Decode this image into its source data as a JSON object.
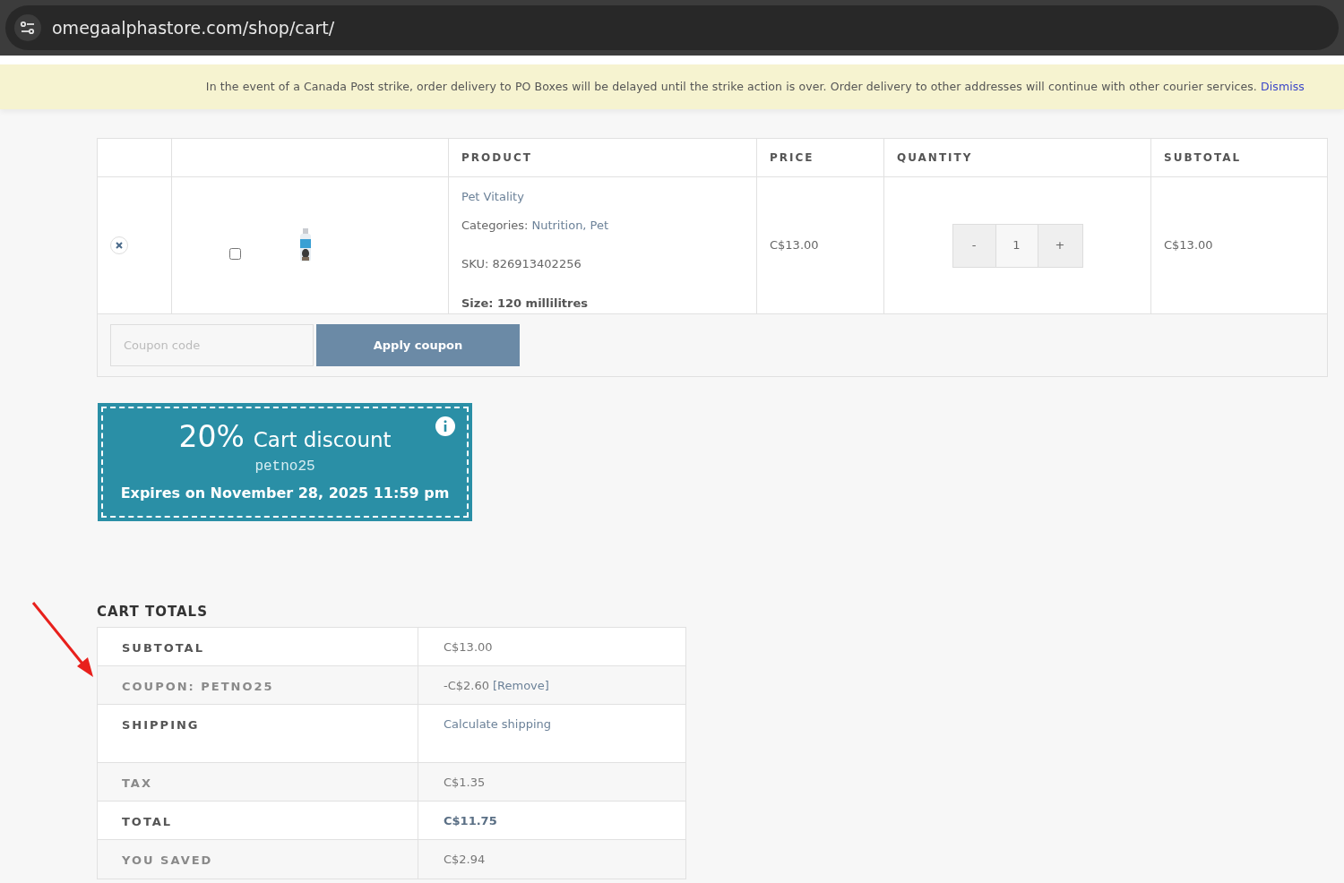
{
  "address_bar": {
    "url": "omegaalphastore.com/shop/cart/"
  },
  "notice": {
    "text": "In the event of a Canada Post strike, order delivery to PO Boxes will be delayed until the strike action is over. Order delivery to other addresses will continue with other courier services.",
    "link": "Dismiss"
  },
  "cart_table": {
    "columns": [
      "PRODUCT",
      "PRICE",
      "QUANTITY",
      "SUBTOTAL"
    ],
    "rows": [
      {
        "checked": false,
        "name": "Pet Vitality",
        "categories_label": "Categories:",
        "categories": [
          "Nutrition,",
          "Pet"
        ],
        "sku": "SKU: 826913402256",
        "size": "Size: 120 millilitres",
        "price": "C$13.00",
        "minus": "-",
        "quantity": "1",
        "plus": "+",
        "subtotal": "C$13.00"
      }
    ],
    "coupon_placeholder": "Coupon code",
    "apply_button": "Apply coupon"
  },
  "coupon_card": {
    "amount": "20%",
    "label": "Cart discount",
    "code": "petno25",
    "expires": "Expires on November 28, 2025 11:59 pm"
  },
  "cart_totals": {
    "title": "CART TOTALS",
    "rows": [
      {
        "label": "SUBTOTAL",
        "value": "C$13.00",
        "kind": "plain"
      },
      {
        "label": "COUPON: PETNO25",
        "value": "-C$2.60",
        "link": "[Remove]",
        "kind": "plain"
      },
      {
        "label": "SHIPPING",
        "link": "Calculate shipping",
        "kind": "tall"
      },
      {
        "label": "TAX",
        "value": "C$1.35",
        "kind": "plain"
      },
      {
        "label": "TOTAL",
        "value": "C$11.75",
        "kind": "strong"
      },
      {
        "label": "YOU SAVED",
        "value": "C$2.94",
        "kind": "plain"
      }
    ]
  }
}
